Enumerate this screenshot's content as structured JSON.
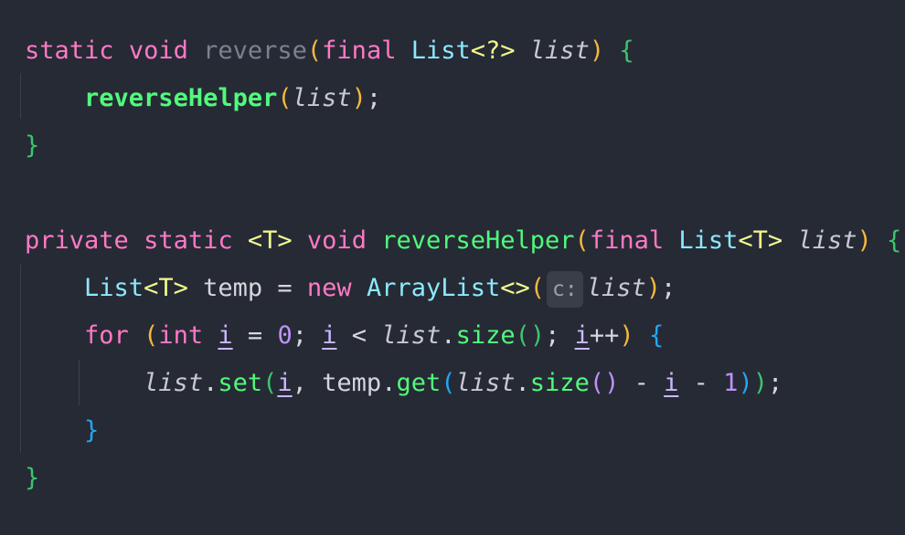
{
  "lines": [
    {
      "tokens": [
        {
          "t": "static",
          "c": "kw"
        },
        {
          "t": " "
        },
        {
          "t": "void",
          "c": "kw"
        },
        {
          "t": " "
        },
        {
          "t": "reverse",
          "c": "unused"
        },
        {
          "t": "(",
          "c": "b-y"
        },
        {
          "t": "final",
          "c": "kw"
        },
        {
          "t": " "
        },
        {
          "t": "List",
          "c": "type"
        },
        {
          "t": "<?>",
          "c": "gen"
        },
        {
          "t": " "
        },
        {
          "t": "list",
          "c": "param"
        },
        {
          "t": ")",
          "c": "b-y"
        },
        {
          "t": " "
        },
        {
          "t": "{",
          "c": "b-g"
        }
      ]
    },
    {
      "tokens": [
        {
          "t": "    "
        },
        {
          "t": "reverseHelper",
          "c": "fn-bold"
        },
        {
          "t": "(",
          "c": "b-y"
        },
        {
          "t": "list",
          "c": "param"
        },
        {
          "t": ")",
          "c": "b-y"
        },
        {
          "t": ";"
        }
      ]
    },
    {
      "tokens": [
        {
          "t": "}",
          "c": "b-g"
        }
      ]
    },
    {
      "tokens": []
    },
    {
      "tokens": [
        {
          "t": "private",
          "c": "kw"
        },
        {
          "t": " "
        },
        {
          "t": "static",
          "c": "kw"
        },
        {
          "t": " "
        },
        {
          "t": "<T>",
          "c": "gen"
        },
        {
          "t": " "
        },
        {
          "t": "void",
          "c": "kw"
        },
        {
          "t": " "
        },
        {
          "t": "reverseHelper",
          "c": "fn"
        },
        {
          "t": "(",
          "c": "b-y"
        },
        {
          "t": "final",
          "c": "kw"
        },
        {
          "t": " "
        },
        {
          "t": "List",
          "c": "type"
        },
        {
          "t": "<T>",
          "c": "gen"
        },
        {
          "t": " "
        },
        {
          "t": "list",
          "c": "param"
        },
        {
          "t": ")",
          "c": "b-y"
        },
        {
          "t": " "
        },
        {
          "t": "{",
          "c": "b-g"
        }
      ]
    },
    {
      "tokens": [
        {
          "t": "    "
        },
        {
          "t": "List",
          "c": "type"
        },
        {
          "t": "<T>",
          "c": "gen"
        },
        {
          "t": " temp = "
        },
        {
          "t": "new",
          "c": "kw"
        },
        {
          "t": " "
        },
        {
          "t": "ArrayList",
          "c": "type"
        },
        {
          "t": "<>",
          "c": "gen"
        },
        {
          "t": "(",
          "c": "b-y"
        },
        {
          "t": "c:",
          "c": "hint"
        },
        {
          "t": "list",
          "c": "param"
        },
        {
          "t": ")",
          "c": "b-y"
        },
        {
          "t": ";"
        }
      ]
    },
    {
      "tokens": [
        {
          "t": "    "
        },
        {
          "t": "for",
          "c": "kw"
        },
        {
          "t": " "
        },
        {
          "t": "(",
          "c": "b-y"
        },
        {
          "t": "int",
          "c": "kw"
        },
        {
          "t": " "
        },
        {
          "t": "i",
          "c": "var"
        },
        {
          "t": " = "
        },
        {
          "t": "0",
          "c": "num"
        },
        {
          "t": "; "
        },
        {
          "t": "i",
          "c": "var"
        },
        {
          "t": " < "
        },
        {
          "t": "list",
          "c": "param"
        },
        {
          "t": "."
        },
        {
          "t": "size",
          "c": "fn"
        },
        {
          "t": "()",
          "c": "b-g"
        },
        {
          "t": "; "
        },
        {
          "t": "i",
          "c": "var"
        },
        {
          "t": "++"
        },
        {
          "t": ")",
          "c": "b-y"
        },
        {
          "t": " "
        },
        {
          "t": "{",
          "c": "b-b"
        }
      ]
    },
    {
      "tokens": [
        {
          "t": "        "
        },
        {
          "t": "list",
          "c": "param"
        },
        {
          "t": "."
        },
        {
          "t": "set",
          "c": "fn"
        },
        {
          "t": "(",
          "c": "b-g"
        },
        {
          "t": "i",
          "c": "var"
        },
        {
          "t": ", temp."
        },
        {
          "t": "get",
          "c": "fn"
        },
        {
          "t": "(",
          "c": "b-b"
        },
        {
          "t": "list",
          "c": "param"
        },
        {
          "t": "."
        },
        {
          "t": "size",
          "c": "fn"
        },
        {
          "t": "()",
          "c": "num"
        },
        {
          "t": " - "
        },
        {
          "t": "i",
          "c": "var"
        },
        {
          "t": " - "
        },
        {
          "t": "1",
          "c": "num"
        },
        {
          "t": ")",
          "c": "b-b"
        },
        {
          "t": ")",
          "c": "b-g"
        },
        {
          "t": ";"
        }
      ]
    },
    {
      "tokens": [
        {
          "t": "    "
        },
        {
          "t": "}",
          "c": "b-b"
        }
      ]
    },
    {
      "tokens": [
        {
          "t": "}",
          "c": "b-g"
        }
      ]
    }
  ]
}
